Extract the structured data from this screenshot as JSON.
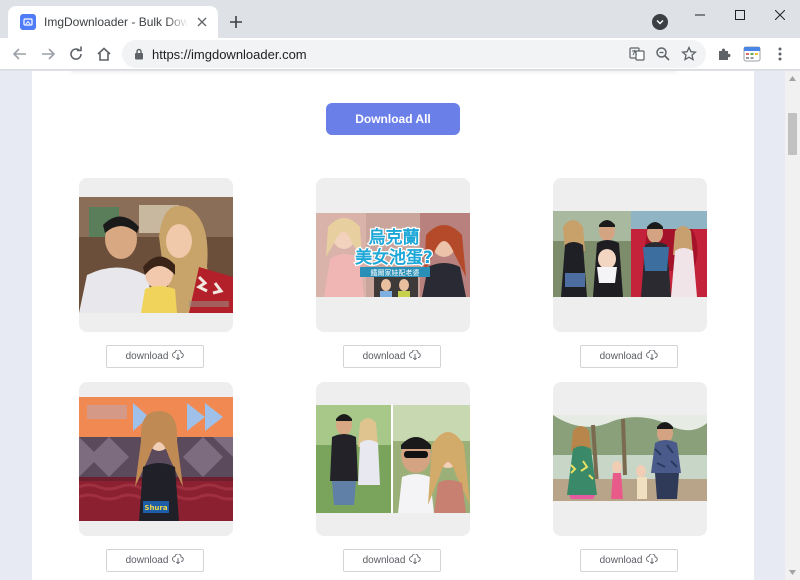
{
  "browser": {
    "tab_title": "ImgDownloader - Bulk Downloader",
    "url": "https://imgdownloader.com"
  },
  "page": {
    "download_all_label": "Download All",
    "download_label": "download"
  },
  "gallery": [
    {
      "caption_alt": "family selfie indoors"
    },
    {
      "caption_alt": "video thumbnail with overlay text"
    },
    {
      "caption_alt": "couple with baby by red wall"
    },
    {
      "caption_alt": "woman on tv stage"
    },
    {
      "caption_alt": "couple selfie collage outdoors"
    },
    {
      "caption_alt": "family outdoors under trees"
    }
  ],
  "thumbnail_texts": {
    "banner_line1": "烏克蘭",
    "banner_line2": "美女池蛋?",
    "banner_sub": "鐵爾家娃配老婆",
    "tv_nameplate": "Shura"
  },
  "colors": {
    "accent": "#6b7fe8",
    "favicon": "#4f7cf7"
  }
}
